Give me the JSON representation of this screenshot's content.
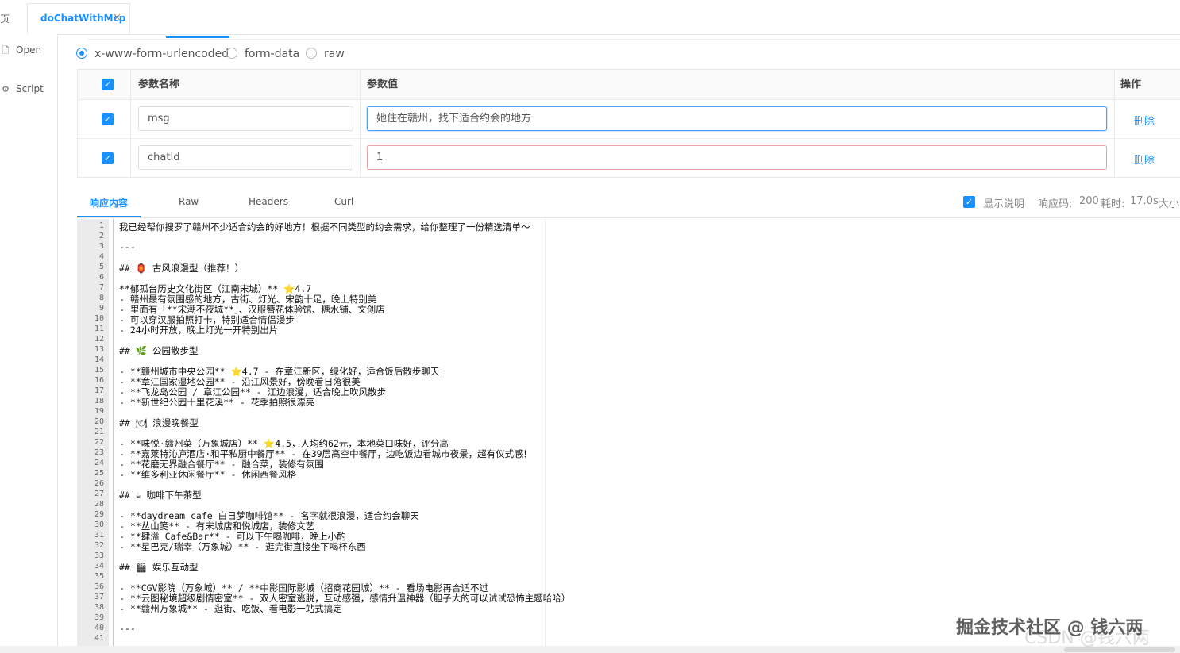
{
  "tabs": {
    "home_label": "主页",
    "active_label": "doChatWithMcp",
    "close_glyph": "×"
  },
  "sidebar": {
    "items": [
      {
        "label": "Open",
        "icon": "file-icon"
      },
      {
        "label": "Script",
        "icon": "gear-icon"
      }
    ]
  },
  "body_types": {
    "selected": "x-www-form-urlencoded",
    "options": [
      "x-www-form-urlencoded",
      "form-data",
      "raw"
    ]
  },
  "params_table": {
    "headers": {
      "name": "参数名称",
      "value": "参数值",
      "actions": "操作"
    },
    "rows": [
      {
        "checked": true,
        "name": "msg",
        "value": "她住在赣州，找下适合约会的地方",
        "action": "删除"
      },
      {
        "checked": true,
        "name": "chatId",
        "value": "1",
        "action": "删除"
      }
    ]
  },
  "response": {
    "tabs": [
      "响应内容",
      "Raw",
      "Headers",
      "Curl"
    ],
    "active_tab": "响应内容",
    "show_desc_label": "显示说明",
    "status_label": "响应码:",
    "status_code": "200",
    "time_label": "耗时:",
    "time_value": "17.0s",
    "size_label": "大小"
  },
  "editor": {
    "lines": [
      "我已经帮你搜罗了赣州不少适合约会的好地方！根据不同类型的约会需求，给你整理了一份精选清单～",
      "",
      "---",
      "",
      "## 🏮 古风浪漫型（推荐！）",
      "",
      "**郁孤台历史文化街区（江南宋城）** ⭐4.7",
      "- 赣州最有氛围感的地方，古街、灯光、宋韵十足，晚上特别美",
      "- 里面有「**宋潮不夜城**」、汉服簪花体验馆、糖水铺、文创店",
      "- 可以穿汉服拍照打卡，特别适合情侣漫步",
      "- 24小时开放，晚上灯光一开特别出片",
      "",
      "## 🌿 公园散步型",
      "",
      "- **赣州城市中央公园** ⭐4.7 - 在章江新区，绿化好，适合饭后散步聊天",
      "- **章江国家湿地公园** - 沿江风景好，傍晚看日落很美",
      "- **飞龙岛公园 / 章江公园** - 江边浪漫，适合晚上吹风散步",
      "- **新世纪公园十里花溪** - 花季拍照很漂亮",
      "",
      "## 🍽 浪漫晚餐型",
      "",
      "- **味悦·赣州菜（万象城店）** ⭐4.5，人均约62元，本地菜口味好，评分高",
      "- **嘉莱特沁庐酒店·和平私厨中餐厅** - 在39层高空中餐厅，边吃饭边看城市夜景，超有仪式感！",
      "- **花磨无界融合餐厅** - 融合菜，装修有氛围",
      "- **维多利亚休闲餐厅** - 休闲西餐风格",
      "",
      "## ☕ 咖啡下午茶型",
      "",
      "- **daydream cafe 白日梦咖啡馆** - 名字就很浪漫，适合约会聊天",
      "- **丛山笺** - 有宋城店和悦城店，装修文艺",
      "- **肆溢 Cafe&Bar** - 可以下午喝咖啡，晚上小酌",
      "- **星巴克/瑞幸（万象城）** - 逛完街直接坐下喝杯东西",
      "",
      "## 🎬 娱乐互动型",
      "",
      "- **CGV影院（万象城）** / **中影国际影城（招商花园城）** - 看场电影再合适不过",
      "- **云图秘境超级剧情密室** - 双人密室逃脱，互动感强，感情升温神器（胆子大的可以试试恐怖主题哈哈）",
      "- **赣州万象城** - 逛街、吃饭、看电影一站式搞定",
      "",
      "---",
      ""
    ]
  },
  "watermark": {
    "main": "掘金技术社区 @ 钱六两",
    "sub": "CSDN @钱六两"
  }
}
